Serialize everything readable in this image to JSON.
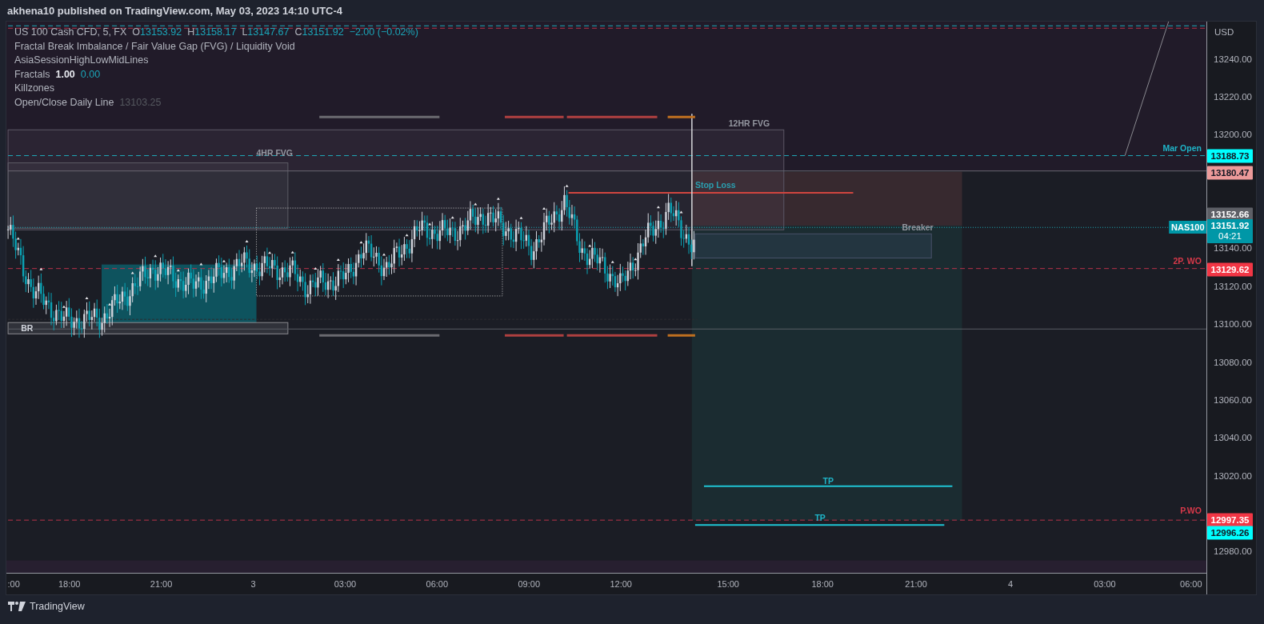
{
  "header": {
    "title": "akhena10 published on TradingView.com, May 03, 2023 14:10 UTC-4"
  },
  "legend": {
    "symbol": "US 100 Cash CFD, 5, FX",
    "ohlc": [
      {
        "label": "O",
        "value": "13153.92"
      },
      {
        "label": "H",
        "value": "13158.17"
      },
      {
        "label": "L",
        "value": "13147.67"
      },
      {
        "label": "C",
        "value": "13151.92"
      }
    ],
    "change": "−2.00 (−0.02%)",
    "indicators": [
      {
        "name": "Fractal Break Imbalance / Fair Value Gap (FVG) / Liquidity Void"
      },
      {
        "name": "AsiaSessionHighLowMidLines"
      },
      {
        "name": "Fractals",
        "values": [
          {
            "text": "1.00",
            "kind": "bold"
          },
          {
            "text": "0.00",
            "kind": "accent"
          }
        ]
      },
      {
        "name": "Killzones"
      },
      {
        "name": "Open/Close Daily Line",
        "values": [
          {
            "text": "13103.25",
            "kind": "dim"
          }
        ]
      }
    ]
  },
  "chart_labels": [
    {
      "text": "4HR FVG",
      "kind": "text",
      "color": "#9598a1"
    },
    {
      "text": "12HR FVG",
      "kind": "text",
      "color": "#9598a1"
    },
    {
      "text": "Stop Loss",
      "kind": "text",
      "color": "#2a9fb0"
    },
    {
      "text": "Breaker",
      "kind": "text",
      "color": "#9598a1"
    },
    {
      "text": "Mar Open",
      "kind": "text",
      "color": "#1fb5c9"
    },
    {
      "text": "2P. WO",
      "kind": "text",
      "color": "#d8394a"
    },
    {
      "text": "P.WO",
      "kind": "text",
      "color": "#d8394a"
    },
    {
      "text": "TP",
      "kind": "text",
      "color": "#1fb5c9"
    },
    {
      "text": "TP",
      "kind": "text",
      "color": "#1fb5c9"
    },
    {
      "text": "BR",
      "kind": "text",
      "color": "#d1d4dc"
    },
    {
      "text": "NAS100",
      "kind": "tag",
      "color": "#0097a7"
    }
  ],
  "price_axis": {
    "currency": "USD",
    "ticks": [
      "13240.00",
      "13220.00",
      "13200.00",
      "13140.00",
      "13120.00",
      "13100.00",
      "13080.00",
      "13060.00",
      "13040.00",
      "13020.00",
      "12980.00"
    ],
    "price_tags": [
      {
        "text": "13188.73",
        "color": "#00ffff"
      },
      {
        "text": "13180.47",
        "color": "#ec9a9a"
      },
      {
        "text": "13152.66",
        "color": "#5d5f66"
      },
      {
        "text": "13151.92",
        "sublabel": "04:21",
        "color": "#0097a7"
      },
      {
        "text": "13129.62",
        "color": "#f23645"
      },
      {
        "text": "12997.35",
        "color": "#f23645"
      },
      {
        "text": "12996.26",
        "color": "#00ffff"
      }
    ]
  },
  "time_axis": {
    "ticks": [
      ":00",
      "18:00",
      "21:00",
      "3",
      "03:00",
      "06:00",
      "09:00",
      "12:00",
      "15:00",
      "18:00",
      "21:00",
      "4",
      "03:00",
      "06:00"
    ]
  },
  "footer": {
    "brand": "TradingView"
  }
}
